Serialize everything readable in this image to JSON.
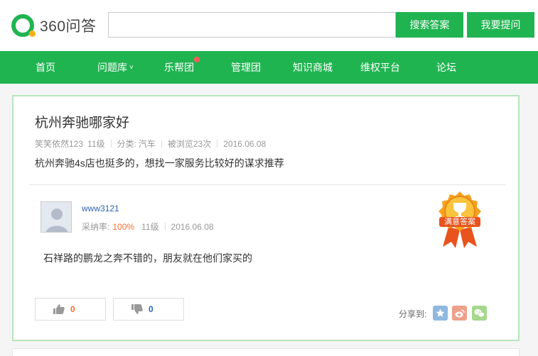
{
  "header": {
    "logo_text": "360问答",
    "search": {
      "value": "",
      "placeholder": ""
    },
    "search_button": "搜索答案",
    "ask_button": "我要提问"
  },
  "nav": {
    "items": [
      {
        "label": "首页"
      },
      {
        "label": "问题库",
        "has_dropdown": true
      },
      {
        "label": "乐帮团",
        "has_notification": true
      },
      {
        "label": "管理团"
      },
      {
        "label": "知识商城"
      },
      {
        "label": "维权平台"
      },
      {
        "label": "论坛"
      }
    ]
  },
  "question": {
    "title": "杭州奔驰哪家好",
    "author": "笑笑依然123",
    "level": "11级",
    "category_label": "分类:",
    "category": "汽车",
    "views": "被浏览23次",
    "date": "2016.06.08",
    "body": "杭州奔驰4s店也挺多的，想找一家服务比较好的谋求推荐"
  },
  "answer": {
    "username": "www3121",
    "adopt_label": "采纳率:",
    "adopt_rate": "100%",
    "level": "11级",
    "date": "2016.06.08",
    "body": "石祥路的鹏龙之奔不错的，朋友就在他们家买的",
    "badge_text": "满意答案",
    "upvotes": "0",
    "downvotes": "0",
    "share_label": "分享到:"
  },
  "colors": {
    "brand_green": "#20b451",
    "accent_orange": "#ff6a2c",
    "link_blue": "#2a64b5",
    "notification_red": "#ff5a5a"
  },
  "icons": [
    "logo-icon",
    "chevron-down-icon",
    "notification-dot-icon",
    "avatar-placeholder-icon",
    "satisfied-answer-badge-icon",
    "thumbs-up-icon",
    "thumbs-down-icon",
    "qzone-icon",
    "weibo-icon",
    "wechat-icon"
  ]
}
